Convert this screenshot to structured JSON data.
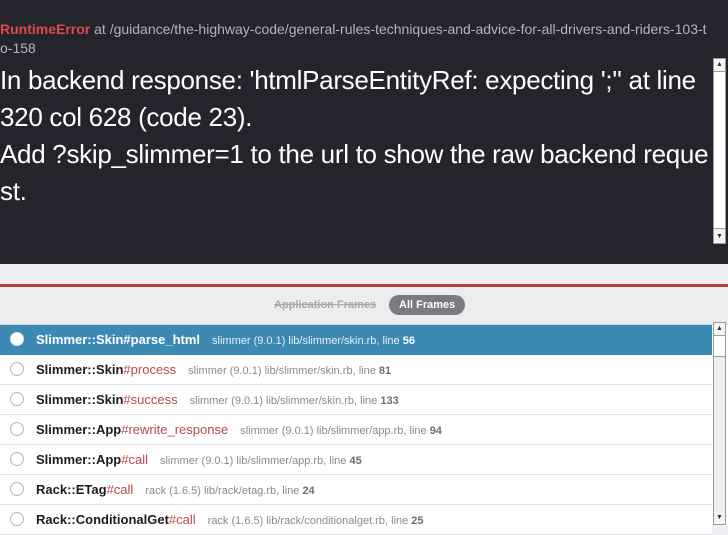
{
  "error": {
    "type": "RuntimeError",
    "location": " at /guidance/the-highway-code/general-rules-techniques-and-advice-for-all-drivers-and-riders-103-to-158",
    "message_line1": "In backend response: 'htmlParseEntityRef: expecting ';'' at line 320 col 628 (code 23).",
    "message_line2": "Add ?skip_slimmer=1 to the url to show the raw backend request."
  },
  "filters": {
    "application_frames": "Application Frames",
    "all_frames": "All Frames"
  },
  "frames": [
    {
      "class": "Slimmer::Skin",
      "method": "#parse_html",
      "location": "slimmer (9.0.1) lib/slimmer/skin.rb, line ",
      "line": "56",
      "selected": true
    },
    {
      "class": "Slimmer::Skin",
      "method": "#process",
      "location": "slimmer (9.0.1) lib/slimmer/skin.rb, line ",
      "line": "81",
      "selected": false
    },
    {
      "class": "Slimmer::Skin",
      "method": "#success",
      "location": "slimmer (9.0.1) lib/slimmer/skin.rb, line ",
      "line": "133",
      "selected": false
    },
    {
      "class": "Slimmer::App",
      "method": "#rewrite_response",
      "location": "slimmer (9.0.1) lib/slimmer/app.rb, line ",
      "line": "94",
      "selected": false
    },
    {
      "class": "Slimmer::App",
      "method": "#call",
      "location": "slimmer (9.0.1) lib/slimmer/app.rb, line ",
      "line": "45",
      "selected": false
    },
    {
      "class": "Rack::ETag",
      "method": "#call",
      "location": "rack (1.6.5) lib/rack/etag.rb, line ",
      "line": "24",
      "selected": false
    },
    {
      "class": "Rack::ConditionalGet",
      "method": "#call",
      "location": "rack (1.6.5) lib/rack/conditionalget.rb, line ",
      "line": "25",
      "selected": false
    }
  ],
  "icons": {
    "scroll_up": "up-arrow-icon",
    "scroll_down": "down-arrow-icon",
    "radio": "radio-circle-icon"
  },
  "colors": {
    "header_bg": "#24242c",
    "error_red": "#e04a4a",
    "selected_row": "#3c8ab4",
    "panel_border": "#b73a3a"
  }
}
